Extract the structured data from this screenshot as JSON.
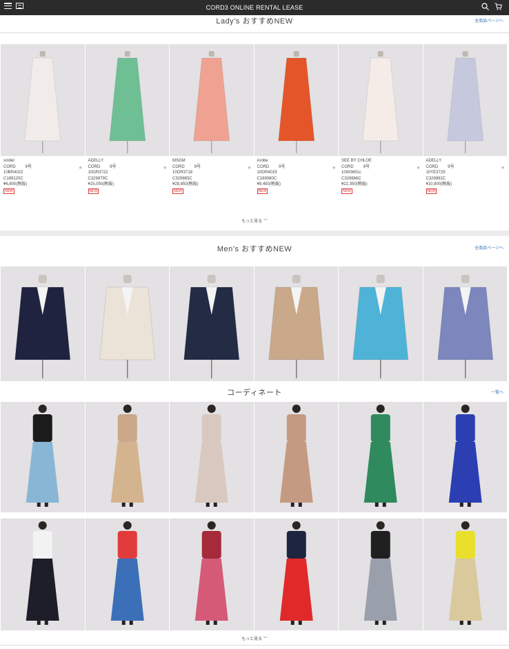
{
  "header": {
    "title": "CORD3 ONLINE RENTAL LEASE"
  },
  "ladies": {
    "title": "Lady’s おすすめNEW",
    "link": "全商品ページへ",
    "more": "もっと見る",
    "badge": "NEW",
    "products": [
      {
        "brand": "snidel",
        "cat": "CORD",
        "size": "9号",
        "code1": "10BR4022",
        "code2": "C189120C",
        "price": "¥6,800(税抜)",
        "color": "#f1ecea"
      },
      {
        "brand": "ADELLY",
        "cat": "CORD",
        "size": "9号",
        "code1": "10GR3722",
        "code2": "C329879C",
        "price": "¥15,050(税抜)",
        "color": "#6fbf95"
      },
      {
        "brand": "MSGM",
        "cat": "CORD",
        "size": "9号",
        "code1": "10OR3718",
        "code2": "C329865C",
        "price": "¥28,850(税抜)",
        "color": "#f0a292"
      },
      {
        "brand": "Arobe",
        "cat": "CORD",
        "size": "9号",
        "code1": "10OR4019",
        "code2": "C189080C",
        "price": "¥9,450(税抜)",
        "color": "#e4562a"
      },
      {
        "brand": "SEE BY CHLOE",
        "cat": "CORD",
        "size": "9号",
        "code1": "10W3691c",
        "code2": "C329666C",
        "price": "¥22,350(税抜)",
        "color": "#f5ece8"
      },
      {
        "brand": "ADELLY",
        "cat": "CORD",
        "size": "9号",
        "code1": "10YE3725",
        "code2": "C329882C",
        "price": "¥10,900(税抜)",
        "color": "#c6c9de"
      }
    ]
  },
  "mens": {
    "title": "Men’s おすすめNEW",
    "link": "全商品ページへ",
    "jackets": [
      {
        "color": "#1f2340"
      },
      {
        "color": "#ece3d8"
      },
      {
        "color": "#232b45"
      },
      {
        "color": "#c9a98a"
      },
      {
        "color": "#4fb3d8"
      },
      {
        "color": "#7d86bd"
      }
    ]
  },
  "coordinate": {
    "title": "コーディネート",
    "link": "一覧へ",
    "more": "もっと見る",
    "row1": [
      {
        "top": "#1b1b1b",
        "bottom": "#8ab6d6"
      },
      {
        "top": "#caa889",
        "bottom": "#d4b48f"
      },
      {
        "top": "#d8c8c0",
        "bottom": "#d8c8c0"
      },
      {
        "top": "#c59a83",
        "bottom": "#c59a83"
      },
      {
        "top": "#2f8a5e",
        "bottom": "#2f8a5e"
      },
      {
        "top": "#2b3fb3",
        "bottom": "#2b3fb3"
      }
    ],
    "row2": [
      {
        "top": "#f2f2f2",
        "bottom": "#1e1e2a"
      },
      {
        "top": "#e23b3b",
        "bottom": "#3b6fb8"
      },
      {
        "top": "#a52a3a",
        "bottom": "#d45a78"
      },
      {
        "top": "#1e2540",
        "bottom": "#e02a2a"
      },
      {
        "top": "#202020",
        "bottom": "#9aa0ab"
      },
      {
        "top": "#e8e02a",
        "bottom": "#d9c99c"
      }
    ]
  }
}
